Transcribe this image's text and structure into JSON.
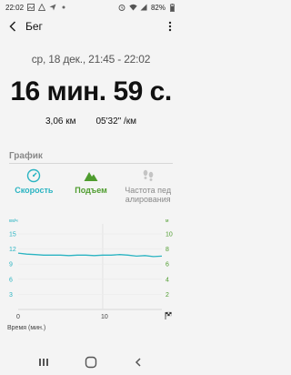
{
  "status_bar": {
    "time": "22:02",
    "battery": "82%"
  },
  "header": {
    "title": "Бег"
  },
  "summary": {
    "date_range": "ср, 18 дек., 21:45 - 22:02",
    "duration": "16 мин. 59 с.",
    "distance": "3,06 км",
    "pace": "05'32\" /км"
  },
  "graph": {
    "section_title": "График",
    "tabs": [
      {
        "label": "Скорость",
        "active": true,
        "color": "#2bb4c2",
        "icon": "speedometer-icon"
      },
      {
        "label": "Подъем",
        "active": false,
        "color": "#4e9c2e",
        "icon": "mountain-icon"
      },
      {
        "label": "Частота пед алирования",
        "active": false,
        "color": "#9a9a9a",
        "icon": "footsteps-icon"
      }
    ]
  },
  "chart_data": {
    "type": "line",
    "left_axis": {
      "unit": "км/ч",
      "ticks": [
        3,
        6,
        9,
        12,
        15
      ],
      "ylim": [
        0,
        17
      ]
    },
    "right_axis": {
      "unit": "м",
      "ticks": [
        2,
        4,
        6,
        8,
        10
      ],
      "ylim": [
        0,
        11.33
      ]
    },
    "x_axis": {
      "label": "Время (мин.)",
      "ticks": [
        0,
        10
      ],
      "xlim": [
        0,
        17
      ],
      "end_icon": "checkered-flag-icon"
    },
    "series": [
      {
        "color": "#2bb4c2",
        "x": [
          0,
          1,
          2,
          3,
          4,
          5,
          6,
          7,
          8,
          9,
          10,
          11,
          12,
          13,
          14,
          15,
          16,
          17
        ],
        "y": [
          11.2,
          11.0,
          10.9,
          10.8,
          10.8,
          10.8,
          10.7,
          10.8,
          10.8,
          10.7,
          10.8,
          10.8,
          10.9,
          10.8,
          10.6,
          10.7,
          10.5,
          10.6
        ]
      }
    ]
  }
}
